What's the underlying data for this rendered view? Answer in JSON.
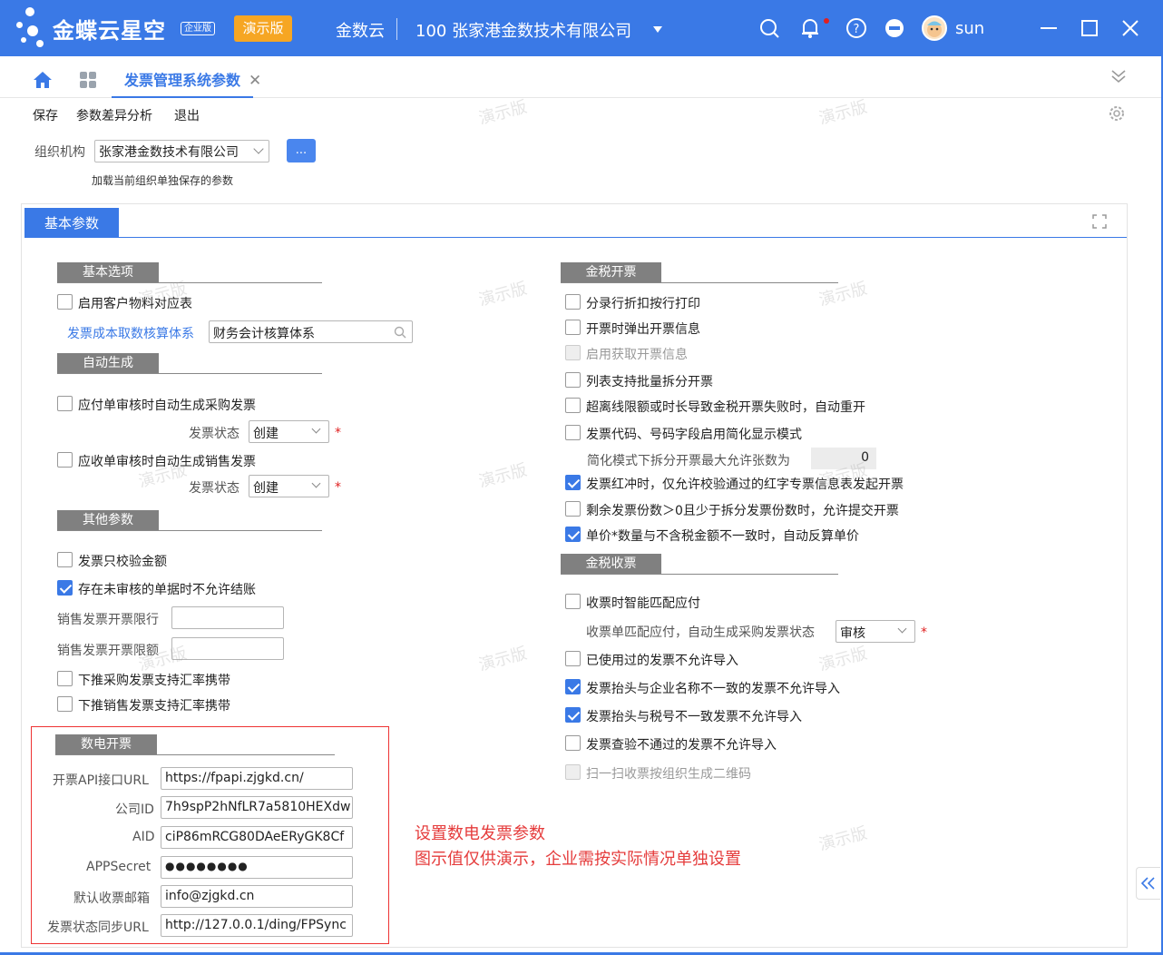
{
  "header": {
    "logo": "金蝶云星空",
    "edition": "企业版",
    "demo_badge": "演示版",
    "tenant": "金数云",
    "company": "100  张家港金数技术有限公司",
    "username": "sun",
    "icons": [
      "search-icon",
      "bell-icon",
      "help-icon",
      "minus-circle-icon",
      "avatar",
      "minimize-icon",
      "maximize-icon",
      "close-icon"
    ]
  },
  "tabs": {
    "active_label": "发票管理系统参数"
  },
  "toolbar": {
    "save": "保存",
    "diff": "参数差异分析",
    "exit": "退出"
  },
  "org": {
    "label": "组织机构",
    "value": "张家港金数技术有限公司",
    "button": "...",
    "note": "加载当前组织单独保存的参数"
  },
  "panel": {
    "tab_label": "基本参数"
  },
  "left": {
    "basic_title": "基本选项",
    "basic_enable_customer": "启用客户物料对应表",
    "cost_label": "发票成本取数核算体系",
    "cost_value": "财务会计核算体系",
    "auto_title": "自动生成",
    "auto_payable": "应付单审核时自动生成采购发票",
    "status_label": "发票状态",
    "status_value": "创建",
    "auto_receivable": "应收单审核时自动生成销售发票",
    "status_label2": "发票状态",
    "status_value2": "创建",
    "other_title": "其他参数",
    "only_amount": "发票只校验金额",
    "no_close": "存在未审核的单据时不允许结账",
    "sales_limit_label": "销售发票开票限行",
    "sales_limit_value": "",
    "sales_amount_label": "销售发票开票限额",
    "sales_amount_value": "",
    "push_purchase": "下推采购发票支持汇率携带",
    "push_sales": "下推销售发票支持汇率携带",
    "digital_title": "数电开票",
    "api_url_label": "开票API接口URL",
    "api_url": "https://fpapi.zjgkd.cn/",
    "company_id_label": "公司ID",
    "company_id": "7h9spP2hNfLR7a5810HEXdw",
    "aid_label": "AID",
    "aid": "ciP86mRCG80DAeERyGK8Cf",
    "secret_label": "APPSecret",
    "secret": "●●●●●●●●",
    "email_label": "默认收票邮箱",
    "email": "info@zjgkd.cn",
    "sync_label": "发票状态同步URL",
    "sync_url": "http://127.0.0.1/ding/FPSync"
  },
  "right": {
    "tax_issue_title": "金税开票",
    "i1": "分录行折扣按行打印",
    "i2": "开票时弹出开票信息",
    "i3": "启用获取开票信息",
    "i4": "列表支持批量拆分开票",
    "i5": "超离线限额或时长导致金税开票失败时，自动重开",
    "i6": "发票代码、号码字段启用简化显示模式",
    "split_label": "简化模式下拆分开票最大允许张数为",
    "split_value": "0",
    "i7": "发票红冲时，仅允许校验通过的红字专票信息表发起开票",
    "i8": "剩余发票份数＞0且少于拆分发票份数时，允许提交开票",
    "i9": "单价*数量与不含税金额不一致时，自动反算单价",
    "tax_receive_title": "金税收票",
    "r1": "收票时智能匹配应付",
    "match_label": "收票单匹配应付，自动生成采购发票状态",
    "match_value": "审核",
    "r2": "已使用过的发票不允许导入",
    "r3": "发票抬头与企业名称不一致的发票不允许导入",
    "r4": "发票抬头与税号不一致发票不允许导入",
    "r5": "发票查验不通过的发票不允许导入",
    "r6": "扫一扫收票按组织生成二维码"
  },
  "annotation": {
    "line1": "设置数电发票参数",
    "line2": "图示值仅供演示，企业需按实际情况单独设置"
  },
  "watermark": "演示版",
  "colors": {
    "brand": "#3a79e6",
    "badge": "#f6a623",
    "annotation": "#e53c3c"
  }
}
